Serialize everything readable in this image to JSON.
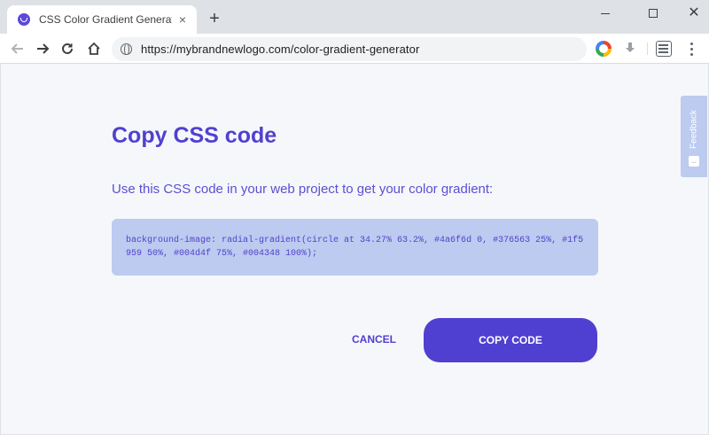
{
  "browser": {
    "tab_title": "CSS Color Gradient Generator",
    "tab_close": "×",
    "new_tab": "+",
    "url": "https://mybrandnewlogo.com/color-gradient-generator",
    "window_controls": {
      "close": "✕"
    }
  },
  "dialog": {
    "title": "Copy CSS code",
    "description": "Use this CSS code in your web project to get your color gradient:",
    "css_code": "background-image: radial-gradient(circle at 34.27% 63.2%, #4a6f6d 0, #376563 25%, #1f5959 50%, #004d4f 75%, #004348 100%);",
    "cancel_label": "CANCEL",
    "copy_label": "COPY CODE"
  },
  "feedback": {
    "label": "Feedback"
  },
  "colors": {
    "accent": "#4f40d1",
    "heading": "#5240cf",
    "code_background": "#bccbef",
    "page_background": "#f6f7fb"
  },
  "icons": [
    "site-favicon",
    "back-arrow-icon",
    "forward-arrow-icon",
    "reload-icon",
    "home-icon",
    "globe-icon",
    "google-extension-icon",
    "download-icon",
    "news-extension-icon",
    "menu-dots-icon",
    "feedback-icon"
  ]
}
